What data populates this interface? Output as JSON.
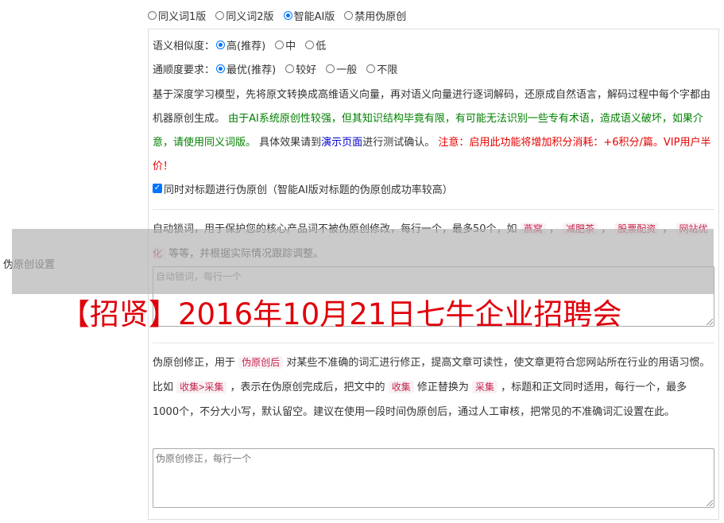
{
  "side_label": "伪原创设置",
  "version_options": [
    {
      "label": "同义词1版",
      "checked": false
    },
    {
      "label": "同义词2版",
      "checked": false
    },
    {
      "label": "智能AI版",
      "checked": true
    },
    {
      "label": "禁用伪原创",
      "checked": false
    }
  ],
  "similarity": {
    "label": "语义相似度：",
    "options": [
      {
        "label": "高(推荐)",
        "checked": true
      },
      {
        "label": "中",
        "checked": false
      },
      {
        "label": "低",
        "checked": false
      }
    ]
  },
  "fluency": {
    "label": "通顺度要求：",
    "options": [
      {
        "label": "最优(推荐)",
        "checked": true
      },
      {
        "label": "较好",
        "checked": false
      },
      {
        "label": "一般",
        "checked": false
      },
      {
        "label": "不限",
        "checked": false
      }
    ]
  },
  "ai_desc": {
    "intro": "基于深度学习模型，先将原文转换成高维语义向量，再对语义向量进行逐词解码，还原成自然语言，解码过程中每个字都由机器原创生成。",
    "warning_green": "由于AI系统原创性较强，但其知识结构毕竟有限，有可能无法识别一些专有术语，造成语义破坏，如果介意，请使用同义词版。",
    "test_pre": "具体效果请到",
    "demo_link": "演示页面",
    "test_post": "进行测试确认。",
    "cost_red": "注意：启用此功能将增加积分消耗：+6积分/篇。VIP用户半价！"
  },
  "title_checkbox": {
    "checked": true,
    "label": "同时对标题进行伪原创（智能AI版对标题的伪原创成功率较高）"
  },
  "lock_words": {
    "desc_pre": "自动锁词，用于保护您的核心产品词不被伪原创修改，每行一个，最多50个，如",
    "examples": [
      "燕窝",
      "减肥茶",
      "股票配资",
      "网站优化"
    ],
    "desc_post": "等等，并根据实际情况跟踪调整。",
    "placeholder": "自动锁词，每行一个"
  },
  "fix_words": {
    "p1": "伪原创修正，用于",
    "kw1": "伪原创后",
    "p2": "对某些不准确的词汇进行修正，提高文章可读性，使文章更符合您网站所在行业的用语习惯。比如",
    "kw2": "收集>采集",
    "p3": "，表示在伪原创完成后，把文中的",
    "kw3": "收集",
    "p4": "修正替换为",
    "kw4": "采集",
    "p5": "，标题和正文同时适用，每行一个，最多1000个，不分大小写，默认留空。建议在使用一段时间伪原创后，通过人工审核，把常见的不准确词汇设置在此。",
    "placeholder": "伪原创修正，每行一个"
  },
  "overlay_title": "【招贤】2016年10月21日七牛企业招聘会",
  "colors": {
    "accent": "#0075ff",
    "green": "#008000",
    "red": "#e60000",
    "link": "#0000cc",
    "overlay_red": "#e0000b"
  }
}
